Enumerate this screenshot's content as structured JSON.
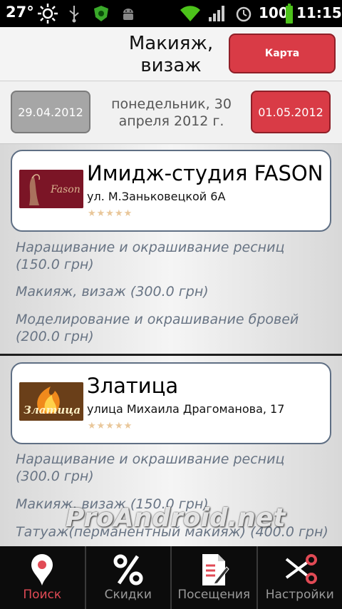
{
  "status_bar": {
    "temperature": "27°",
    "battery": "100",
    "time": "11:15"
  },
  "header": {
    "title_line1": "Макияж,",
    "title_line2": "визаж",
    "map_button": "Карта"
  },
  "date_nav": {
    "prev": "29.04.2012",
    "current_line1": "понедельник, 30",
    "current_line2": "апреля 2012 г.",
    "next": "01.05.2012"
  },
  "salons": [
    {
      "name": "Имидж-студия FASON",
      "address": "ул. М.Заньковецкой 6А",
      "rating_stars": "★★★★★",
      "logo_text": "Fason",
      "services": [
        {
          "line1": "Наращивание и окрашивание ресниц",
          "line2": "(150.0 грн)"
        },
        {
          "line1": "Макияж, визаж  (300.0 грн)",
          "line2": ""
        },
        {
          "line1": "Моделирование и окрашивание бровей",
          "line2": "(200.0 грн)"
        }
      ]
    },
    {
      "name": "Златица",
      "address": "улица Михаила Драгоманова, 17",
      "rating_stars": "★★★★★",
      "logo_text": "Златица",
      "services": [
        {
          "line1": "Наращивание и окрашивание ресниц",
          "line2": "(300.0 грн)"
        },
        {
          "line1": "Макияж, визаж  (150.0 грн)",
          "line2": ""
        },
        {
          "line1": "Татуаж(перманентный макияж)  (400.0 грн)",
          "line2": ""
        }
      ]
    }
  ],
  "watermark": "ProAndroid.net",
  "bottom_nav": [
    {
      "label": "Поиск",
      "icon": "map-pin-icon",
      "active": true
    },
    {
      "label": "Скидки",
      "icon": "percent-icon",
      "active": false
    },
    {
      "label": "Посещения",
      "icon": "document-icon",
      "active": false
    },
    {
      "label": "Настройки",
      "icon": "scissors-icon",
      "active": false
    }
  ],
  "colors": {
    "accent_red": "#d93b46",
    "service_text": "#687484",
    "card_border": "#5f6f84"
  }
}
